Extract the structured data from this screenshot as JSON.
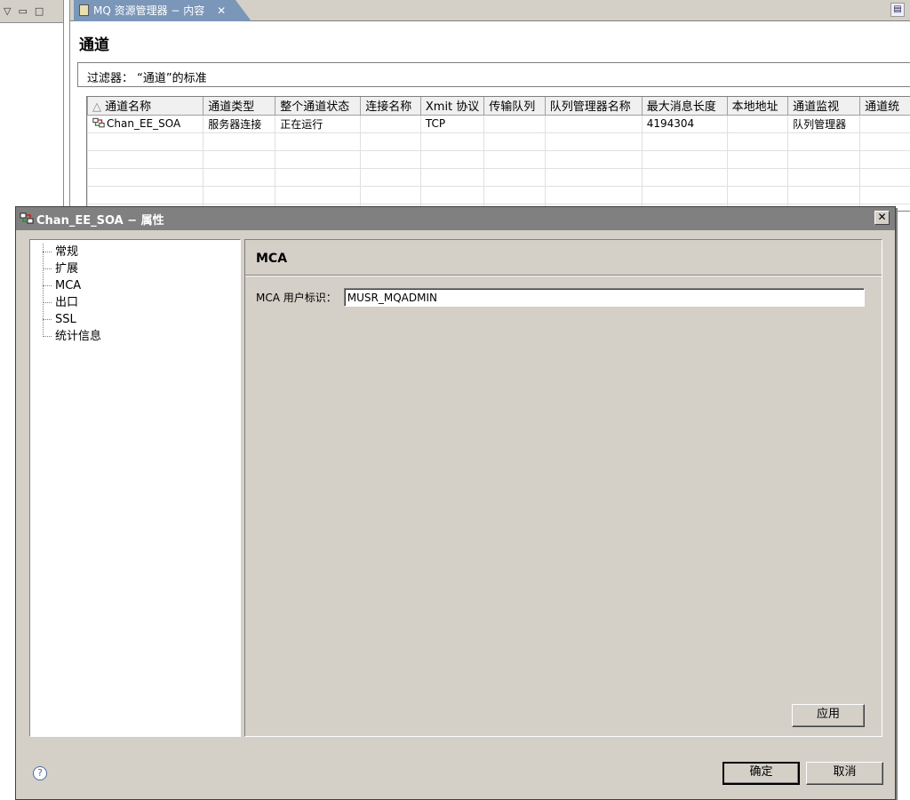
{
  "editor": {
    "tab_title": "MQ 资源管理器 − 内容",
    "tab_close": "✕",
    "section_title": "通道",
    "filter_text": "过滤器：  “通道”的标准"
  },
  "grid": {
    "columns": [
      "通道名称",
      "通道类型",
      "整个通道状态",
      "连接名称",
      "Xmit 协议",
      "传输队列",
      "队列管理器名称",
      "最大消息长度",
      "本地地址",
      "通道监视",
      "通道统"
    ],
    "rows": [
      [
        "Chan_EE_SOA",
        "服务器连接",
        "正在运行",
        "",
        "TCP",
        "",
        "",
        "4194304",
        "",
        "队列管理器",
        ""
      ]
    ]
  },
  "dialog": {
    "title": "Chan_EE_SOA − 属性",
    "close": "✕",
    "tree": [
      "常规",
      "扩展",
      "MCA",
      "出口",
      "SSL",
      "统计信息"
    ],
    "selected_page": "MCA",
    "page_header": "MCA",
    "mca_user_label": "MCA 用户标识：",
    "mca_user_value": "MUSR_MQADMIN",
    "apply": "应用",
    "ok": "确定",
    "cancel": "取消",
    "help": "?"
  }
}
